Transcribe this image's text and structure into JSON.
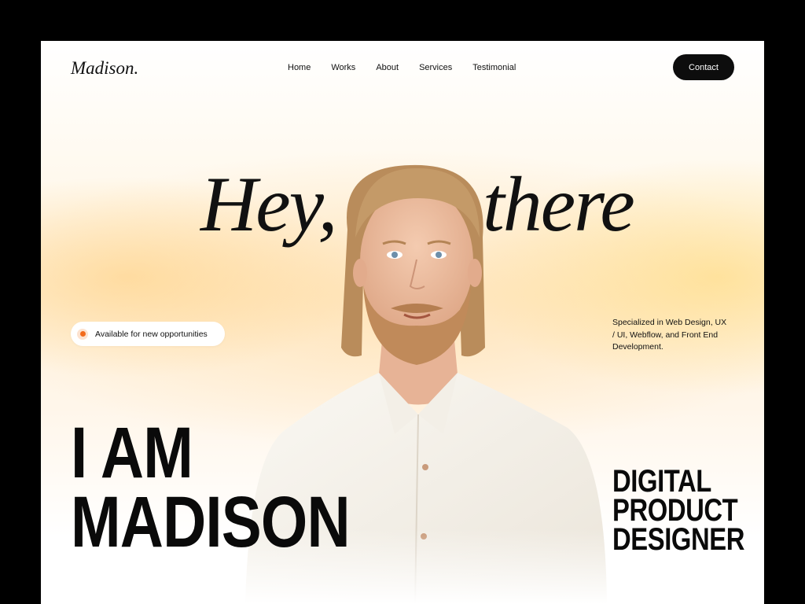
{
  "logo": "Madison.",
  "nav": {
    "items": [
      "Home",
      "Works",
      "About",
      "Services",
      "Testimonial"
    ],
    "contact_label": "Contact"
  },
  "hero": {
    "greeting_left": "Hey,",
    "greeting_right": "there",
    "availability_badge": "Available for new opportunities",
    "specialization": "Specialized in Web Design, UX / UI, Webflow, and Front End Development.",
    "name_line1": "I AM",
    "name_line2": "MADISON",
    "role_line1": "DIGITAL",
    "role_line2": "PRODUCT",
    "role_line3": "DESIGNER"
  },
  "colors": {
    "accent_dot": "#f26b1d",
    "button_bg": "#0d0d0d",
    "glow": "#ffd896"
  }
}
